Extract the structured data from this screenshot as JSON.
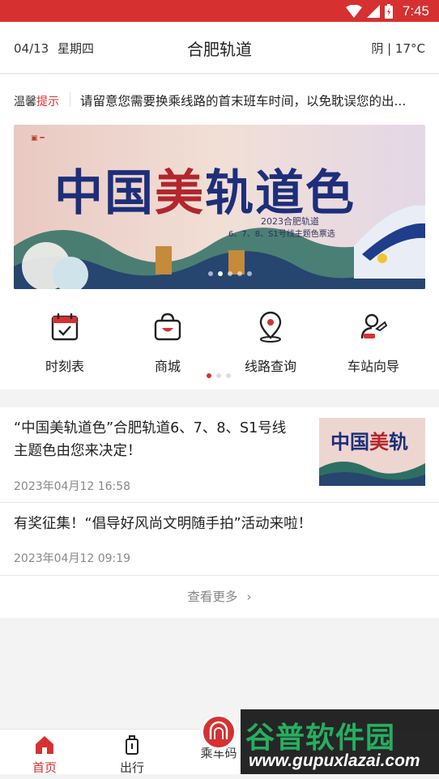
{
  "status_bar": {
    "time": "7:45",
    "color": "#d63031"
  },
  "header": {
    "date": "04/13",
    "weekday": "星期四",
    "title": "合肥轨道",
    "weather": "阴 | 17°C"
  },
  "notice": {
    "tag_prefix": "温馨",
    "tag_suffix": "提示",
    "text": "请留意您需要换乘线路的首末班车时间，以免耽误您的出..."
  },
  "banner": {
    "title_part1": "中国",
    "title_mei": "美",
    "title_part2": "轨道色",
    "subtitle_line1": "2023合肥轨道",
    "subtitle_line2": "6、7、8、S1号线主题色票选",
    "slide_count": 5,
    "active_slide": 1
  },
  "quick_menu": {
    "items": [
      {
        "label": "时刻表",
        "icon": "calendar-check-icon"
      },
      {
        "label": "商城",
        "icon": "shopping-bag-icon"
      },
      {
        "label": "线路查询",
        "icon": "map-pin-icon"
      },
      {
        "label": "车站向导",
        "icon": "station-guide-icon"
      }
    ],
    "page_count": 3,
    "active_page": 0
  },
  "news": {
    "items": [
      {
        "title_line1": "“中国美轨道色”合肥轨道6、7、8、S1号线",
        "title_line2": "主题色由您来决定！",
        "time": "2023年04月12 16:58",
        "has_thumb": true
      },
      {
        "title_line1": "有奖征集！“倡导好风尚文明随手拍”活动来啦！",
        "time": "2023年04月12 09:19",
        "has_thumb": false
      }
    ],
    "more_label": "查看更多"
  },
  "tabbar": {
    "tabs": [
      {
        "label": "首页",
        "icon": "home-icon",
        "active": true
      },
      {
        "label": "出行",
        "icon": "luggage-icon",
        "active": false
      },
      {
        "label": "乘车码",
        "icon": "tunnel-icon",
        "active": false
      }
    ],
    "accent": "#d63031"
  },
  "watermark": {
    "brand": "谷普软件园",
    "url": "www.gupuxlazai.com"
  }
}
